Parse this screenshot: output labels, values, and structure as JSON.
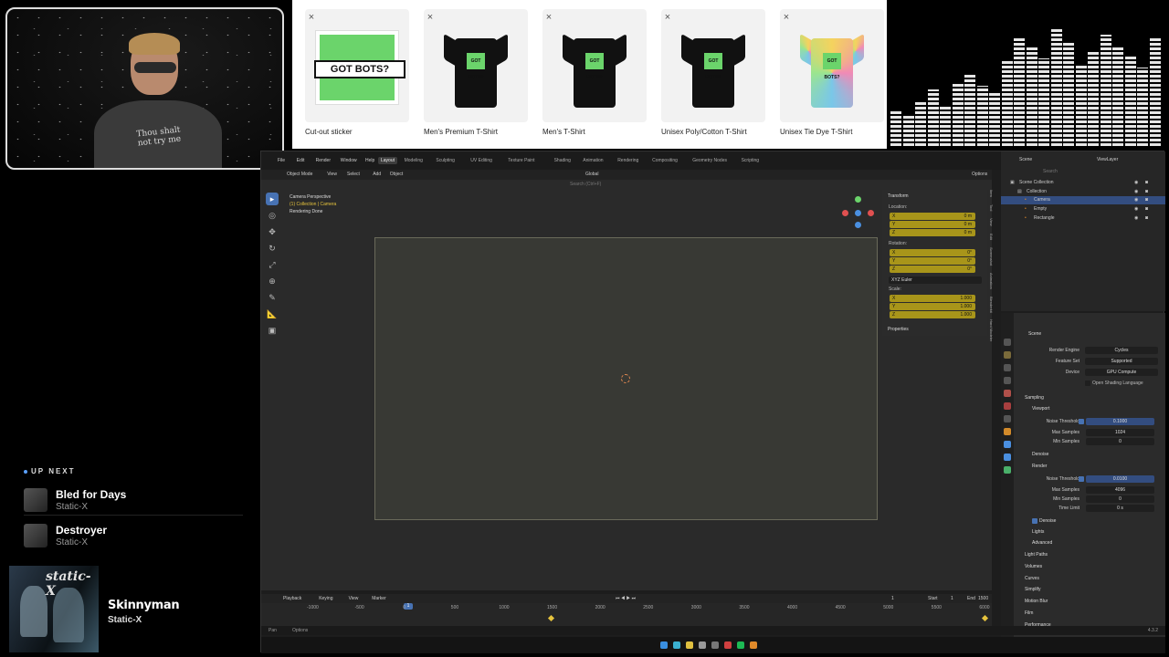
{
  "webcam": {
    "shirt_text": "Thou shalt not try me"
  },
  "merch": [
    {
      "label": "Cut-out sticker",
      "thumb_text": "GOT BOTS?",
      "kind": "sticker"
    },
    {
      "label": "Men's Premium T-Shirt",
      "thumb_text": "GOT BOTS?",
      "kind": "black-shirt"
    },
    {
      "label": "Men's T-Shirt",
      "thumb_text": "GOT BOTS?",
      "kind": "black-shirt"
    },
    {
      "label": "Unisex Poly/Cotton T-Shirt",
      "thumb_text": "GOT BOTS?",
      "kind": "black-shirt"
    },
    {
      "label": "Unisex Tie Dye T-Shirt",
      "thumb_text": "GOT BOTS?",
      "kind": "tiedye-shirt"
    }
  ],
  "close_glyph": "×",
  "up_next": {
    "header": "UP NEXT",
    "tracks": [
      {
        "title": "Bled for Days",
        "artist": "Static-X"
      },
      {
        "title": "Destroyer",
        "artist": "Static-X"
      }
    ],
    "now_playing": {
      "title": "Skinnyman",
      "artist": "Static-X",
      "album_text": "static-X"
    }
  },
  "blender": {
    "menu": [
      "File",
      "Edit",
      "Render",
      "Window",
      "Help"
    ],
    "workspaces": [
      "Layout",
      "Modeling",
      "Sculpting",
      "UV Editing",
      "Texture Paint",
      "Shading",
      "Animation",
      "Rendering",
      "Compositing",
      "Geometry Nodes",
      "Scripting"
    ],
    "active_workspace": "Layout",
    "viewport_menu": [
      "Object Mode",
      "View",
      "Select",
      "Add",
      "Object"
    ],
    "orientation": "Global",
    "options_label": "Options",
    "search_placeholder": "Search (Ctrl+F)",
    "viewport_info": {
      "line1": "Camera Perspective",
      "line2": "(1) Collection | Camera",
      "line3": "Rendering Done"
    },
    "npanel": {
      "transform": "Transform",
      "location": "Location:",
      "location_vals": [
        {
          "k": "X",
          "v": "0 m"
        },
        {
          "k": "Y",
          "v": "0 m"
        },
        {
          "k": "Z",
          "v": "0 m"
        }
      ],
      "rotation": "Rotation:",
      "rotation_vals": [
        {
          "k": "X",
          "v": "0°"
        },
        {
          "k": "Y",
          "v": "0°"
        },
        {
          "k": "Z",
          "v": "0°"
        }
      ],
      "rotation_mode": "XYZ Euler",
      "scale": "Scale:",
      "scale_vals": [
        {
          "k": "X",
          "v": "1.000"
        },
        {
          "k": "Y",
          "v": "1.000"
        },
        {
          "k": "Z",
          "v": "1.000"
        }
      ],
      "properties": "Properties"
    },
    "side_tabs": [
      "Item",
      "Tool",
      "View",
      "Edit",
      "Screenshot",
      "Animation",
      "Blenderkit",
      "Hard Modeler"
    ],
    "outliner": {
      "header": "Scene",
      "view_layer": "ViewLayer",
      "search_placeholder": "Search",
      "rows": [
        {
          "label": "Scene Collection",
          "indent": 0
        },
        {
          "label": "Collection",
          "indent": 1
        },
        {
          "label": "Camera",
          "indent": 2,
          "selected": true
        },
        {
          "label": "Empty",
          "indent": 2
        },
        {
          "label": "Rectangle",
          "indent": 2
        }
      ]
    },
    "properties": {
      "scene": "Scene",
      "render_engine_label": "Render Engine",
      "render_engine": "Cycles",
      "feature_set_label": "Feature Set",
      "feature_set": "Supported",
      "device_label": "Device",
      "device": "GPU Compute",
      "osl": "Open Shading Language",
      "sampling": "Sampling",
      "viewport": "Viewport",
      "noise_threshold_label": "Noise Threshold",
      "vp_noise": "0.1000",
      "max_samples_label": "Max Samples",
      "vp_max": "1024",
      "min_samples_label": "Min Samples",
      "vp_min": "0",
      "denoise": "Denoise",
      "render": "Render",
      "r_noise": "0.0100",
      "r_max": "4096",
      "r_min": "0",
      "time_limit_label": "Time Limit",
      "r_time": "0 s",
      "lights": "Lights",
      "advanced": "Advanced",
      "sections": [
        "Light Paths",
        "Volumes",
        "Curves",
        "Simplify",
        "Motion Blur",
        "Film",
        "Performance"
      ]
    },
    "timeline": {
      "menu": [
        "Playback",
        "Keying",
        "View",
        "Marker"
      ],
      "current_frame": "1",
      "start_label": "Start",
      "start": "1",
      "end_label": "End",
      "end": "1500",
      "ticks": [
        "-1000",
        "-500",
        "0",
        "500",
        "1000",
        "1500",
        "2000",
        "2500",
        "3000",
        "3500",
        "4000",
        "4500",
        "5000",
        "5500",
        "6000"
      ]
    },
    "status": {
      "left": "Pan",
      "mid": "Options",
      "version": "4.3.2"
    }
  },
  "colors": {
    "accent": "#4772b3",
    "field_yellow": "#a8951a",
    "kit_green": "#6bd46b"
  }
}
